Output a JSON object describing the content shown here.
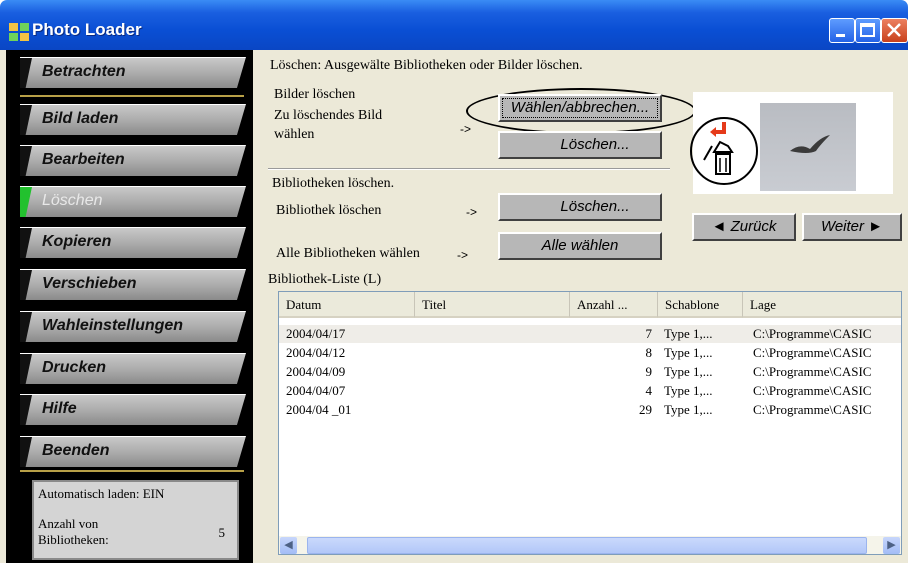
{
  "window": {
    "title": "Photo Loader"
  },
  "nav": {
    "items": [
      {
        "label": "Betrachten"
      },
      {
        "label": "Bild laden"
      },
      {
        "label": "Bearbeiten"
      },
      {
        "label": "Löschen"
      },
      {
        "label": "Kopieren"
      },
      {
        "label": "Verschieben"
      },
      {
        "label": "Wahleinstellungen"
      },
      {
        "label": "Drucken"
      },
      {
        "label": "Hilfe"
      },
      {
        "label": "Beenden"
      }
    ],
    "active": "Löschen"
  },
  "status": {
    "autoload": "Automatisch laden: EIN",
    "libcount_label": "Anzahl von Bibliotheken:",
    "libcount_value": "5"
  },
  "main": {
    "heading": "Löschen: Ausgewälte Bibliotheken oder Bilder löschen.",
    "delete_images_title": "Bilder löschen",
    "select_image_label_1": "Zu löschendes Bild",
    "select_image_label_2": "wählen",
    "arrow": "->",
    "select_cancel_button": "Wählen/abbrechen...",
    "delete_image_button": "Löschen...",
    "delete_libs_title": "Bibliotheken löschen.",
    "delete_lib_label": "Bibliothek löschen",
    "delete_lib_button": "Löschen...",
    "select_all_label": "Alle Bibliotheken wählen",
    "select_all_button": "Alle wählen",
    "back_button": "◄ Zurück",
    "next_button": "Weiter ►",
    "list_label": "Bibliothek-Liste (L)"
  },
  "list": {
    "columns": [
      "Datum",
      "Titel",
      "Anzahl ...",
      "Schablone",
      "Lage"
    ],
    "rows": [
      [
        "2004/04/17",
        "",
        "7",
        "Type 1,...",
        "C:\\Programme\\CASIC"
      ],
      [
        "2004/04/12",
        "",
        "8",
        "Type 1,...",
        "C:\\Programme\\CASIC"
      ],
      [
        "2004/04/09",
        "",
        "9",
        "Type 1,...",
        "C:\\Programme\\CASIC"
      ],
      [
        "2004/04/07",
        "",
        "4",
        "Type 1,...",
        "C:\\Programme\\CASIC"
      ],
      [
        "2004/04 _01",
        "",
        "29",
        "Type 1,...",
        "C:\\Programme\\CASIC"
      ]
    ]
  },
  "colors": {
    "titlebar": "#0a4fd4",
    "panel": "#000000",
    "active_mark": "#22c12e",
    "frame": "#ece9d8"
  }
}
